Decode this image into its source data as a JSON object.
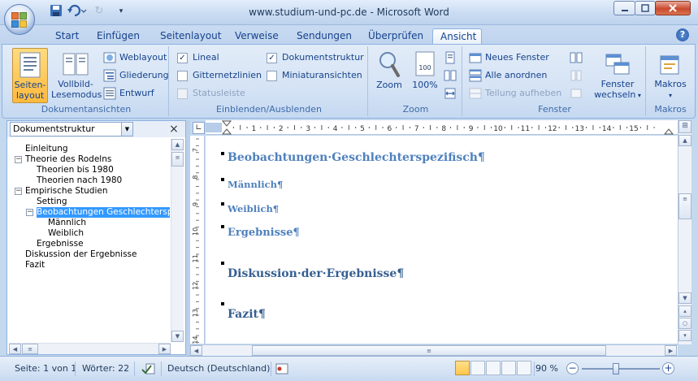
{
  "window": {
    "title": "www.studium-und-pc.de - Microsoft Word"
  },
  "tabs": [
    "Start",
    "Einfügen",
    "Seitenlayout",
    "Verweise",
    "Sendungen",
    "Überprüfen",
    "Ansicht"
  ],
  "active_tab": "Ansicht",
  "ribbon": {
    "dokumentansichten": {
      "label": "Dokumentansichten",
      "seitenlayout": [
        "Seiten-",
        "layout"
      ],
      "vollbild": [
        "Vollbild-",
        "Lesemodus"
      ],
      "weblayout": "Weblayout",
      "gliederung": "Gliederung",
      "entwurf": "Entwurf"
    },
    "einblenden": {
      "label": "Einblenden/Ausblenden",
      "lineal": "Lineal",
      "gitternetzlinien": "Gitternetzlinien",
      "statusleiste": "Statusleiste",
      "dokumentstruktur": "Dokumentstruktur",
      "miniaturansichten": "Miniaturansichten"
    },
    "zoom": {
      "label": "Zoom",
      "zoom": "Zoom",
      "hundred": "100%"
    },
    "fenster": {
      "label": "Fenster",
      "neues_fenster": "Neues Fenster",
      "alle_anordnen": "Alle anordnen",
      "teilung": "Teilung aufheben",
      "wechseln": [
        "Fenster",
        "wechseln"
      ]
    },
    "makros": {
      "label": "Makros",
      "makros": "Makros"
    }
  },
  "navpane": {
    "dropdown": "Dokumentstruktur",
    "close": "×",
    "items": [
      {
        "text": "Einleitung"
      },
      {
        "text": "Theorie des Rodelns",
        "toggle": "−"
      },
      {
        "text": "Theorien bis 1980"
      },
      {
        "text": "Theorien nach 1980"
      },
      {
        "text": "Empirische Studien",
        "toggle": "−"
      },
      {
        "text": "Setting"
      },
      {
        "text": "Beobachtungen Geschlechterspezifisch",
        "toggle": "−",
        "selected": true
      },
      {
        "text": "Männlich"
      },
      {
        "text": "Weiblich"
      },
      {
        "text": "Ergebnisse"
      },
      {
        "text": "Diskussion der Ergebnisse"
      },
      {
        "text": "Fazit"
      }
    ]
  },
  "ruler": {
    "tick_labels": [
      "1",
      "2",
      "3",
      "4",
      "5",
      "6",
      "7",
      "8",
      "9",
      "10",
      "11",
      "12",
      "13",
      "14",
      "15"
    ],
    "v_tick_labels": [
      "7",
      "8",
      "9",
      "10",
      "11",
      "12",
      "13",
      "14"
    ]
  },
  "document": {
    "headings": [
      {
        "text": "Beobachtungen·Geschlechterspezifisch¶"
      },
      {
        "text": "Männlich¶"
      },
      {
        "text": "Weiblich¶"
      },
      {
        "text": "Ergebnisse¶"
      },
      {
        "text": "Diskussion·der·Ergebnisse¶"
      },
      {
        "text": "Fazit¶"
      }
    ]
  },
  "statusbar": {
    "page": "Seite: 1 von 1",
    "words": "Wörter: 22",
    "language": "Deutsch (Deutschland)",
    "zoom": "90 %",
    "zoom_minus": "−",
    "zoom_plus": "+"
  },
  "colors": {
    "heading": "#4f81bd",
    "selection": "#3399ff",
    "ribbon": "#d5e3f5"
  }
}
